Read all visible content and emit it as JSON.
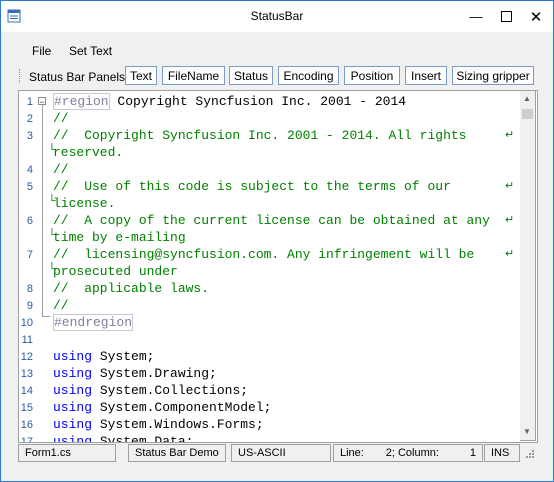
{
  "window": {
    "title": "StatusBar"
  },
  "menu": [
    "File",
    "Set Text"
  ],
  "toolbar": {
    "label": "Status Bar Panels:",
    "buttons": [
      "Text",
      "FileName",
      "Status",
      "Encoding",
      "Position",
      "Insert",
      "Sizing gripper"
    ]
  },
  "editor": {
    "lines": [
      {
        "num": "1",
        "parts": [
          {
            "c": "region",
            "t": "#region"
          },
          {
            "c": "plain",
            "t": " Copyright Syncfusion Inc. 2001 - 2014"
          }
        ]
      },
      {
        "num": "2",
        "parts": [
          {
            "c": "comment",
            "t": "//"
          }
        ]
      },
      {
        "num": "3",
        "parts": [
          {
            "c": "comment",
            "t": "//  Copyright Syncfusion Inc. 2001 - 2014. All rights"
          }
        ]
      },
      {
        "num": "",
        "parts": [
          {
            "c": "comment",
            "t": "reserved."
          }
        ]
      },
      {
        "num": "4",
        "parts": [
          {
            "c": "comment",
            "t": "//"
          }
        ]
      },
      {
        "num": "5",
        "parts": [
          {
            "c": "comment",
            "t": "//  Use of this code is subject to the terms of our"
          }
        ]
      },
      {
        "num": "",
        "parts": [
          {
            "c": "comment",
            "t": "license."
          }
        ]
      },
      {
        "num": "6",
        "parts": [
          {
            "c": "comment",
            "t": "//  A copy of the current license can be obtained at any"
          }
        ]
      },
      {
        "num": "",
        "parts": [
          {
            "c": "comment",
            "t": "time by e-mailing"
          }
        ]
      },
      {
        "num": "7",
        "parts": [
          {
            "c": "comment",
            "t": "//  licensing@syncfusion.com. Any infringement will be"
          }
        ]
      },
      {
        "num": "",
        "parts": [
          {
            "c": "comment",
            "t": "prosecuted under"
          }
        ]
      },
      {
        "num": "8",
        "parts": [
          {
            "c": "comment",
            "t": "//  applicable laws."
          }
        ]
      },
      {
        "num": "9",
        "parts": [
          {
            "c": "comment",
            "t": "//"
          }
        ]
      },
      {
        "num": "10",
        "parts": [
          {
            "c": "region",
            "t": "#endregion"
          }
        ]
      },
      {
        "num": "11",
        "parts": []
      },
      {
        "num": "12",
        "parts": [
          {
            "c": "kw",
            "t": "using"
          },
          {
            "c": "plain",
            "t": " System;"
          }
        ]
      },
      {
        "num": "13",
        "parts": [
          {
            "c": "kw",
            "t": "using"
          },
          {
            "c": "plain",
            "t": " System.Drawing;"
          }
        ]
      },
      {
        "num": "14",
        "parts": [
          {
            "c": "kw",
            "t": "using"
          },
          {
            "c": "plain",
            "t": " System.Collections;"
          }
        ]
      },
      {
        "num": "15",
        "parts": [
          {
            "c": "kw",
            "t": "using"
          },
          {
            "c": "plain",
            "t": " System.ComponentModel;"
          }
        ]
      },
      {
        "num": "16",
        "parts": [
          {
            "c": "kw",
            "t": "using"
          },
          {
            "c": "plain",
            "t": " System.Windows.Forms;"
          }
        ]
      },
      {
        "num": "17",
        "parts": [
          {
            "c": "kw",
            "t": "using"
          },
          {
            "c": "plain",
            "t": " System.Data;"
          }
        ]
      }
    ]
  },
  "status": {
    "filename": "Form1.cs",
    "text": "Status Bar Demo",
    "encoding": "US-ASCII",
    "line_label": "Line:",
    "line_value": "2;",
    "column_label": "Column:",
    "column_value": "1",
    "insert": "INS"
  },
  "icons": {
    "app": "app-window-icon",
    "minimize": "minimize-icon",
    "maximize": "maximize-icon",
    "close": "close-icon",
    "fold": "collapse-icon",
    "wrap": "word-wrap-icon",
    "gripper": "sizing-gripper-icon"
  }
}
